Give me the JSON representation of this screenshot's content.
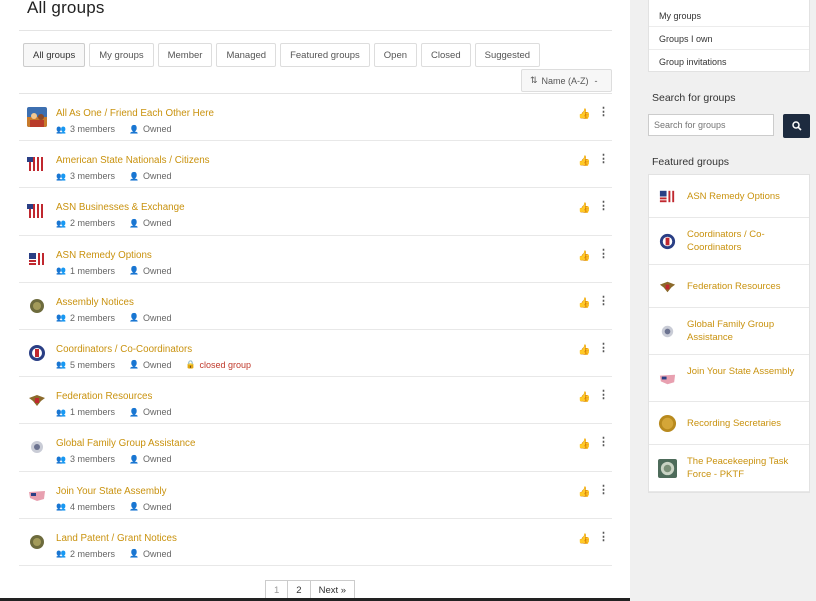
{
  "page": {
    "title": "All groups"
  },
  "tabs": [
    {
      "label": "All groups",
      "active": true
    },
    {
      "label": "My groups"
    },
    {
      "label": "Member"
    },
    {
      "label": "Managed"
    },
    {
      "label": "Featured groups"
    },
    {
      "label": "Open"
    },
    {
      "label": "Closed"
    },
    {
      "label": "Suggested"
    }
  ],
  "sort": {
    "label": "Name (A-Z)",
    "caret": "-"
  },
  "groups": [
    {
      "name": "All As One / Friend Each Other Here",
      "members": "3 members",
      "role": "Owned",
      "icon": "photo-avatar"
    },
    {
      "name": "American State Nationals / Citizens",
      "members": "3 members",
      "role": "Owned",
      "icon": "flag-stripes"
    },
    {
      "name": "ASN Businesses & Exchange",
      "members": "2 members",
      "role": "Owned",
      "icon": "flag-stripes"
    },
    {
      "name": "ASN Remedy Options",
      "members": "1 members",
      "role": "Owned",
      "icon": "flag-mini"
    },
    {
      "name": "Assembly Notices",
      "members": "2 members",
      "role": "Owned",
      "icon": "seal"
    },
    {
      "name": "Coordinators / Co-Coordinators",
      "members": "5 members",
      "role": "Owned",
      "closed": "closed group",
      "icon": "emblem"
    },
    {
      "name": "Federation Resources",
      "members": "1 members",
      "role": "Owned",
      "icon": "eagle"
    },
    {
      "name": "Global Family Group Assistance",
      "members": "3 members",
      "role": "Owned",
      "icon": "seal-grey"
    },
    {
      "name": "Join Your State Assembly",
      "members": "4 members",
      "role": "Owned",
      "icon": "map"
    },
    {
      "name": "Land Patent / Grant Notices",
      "members": "2 members",
      "role": "Owned",
      "icon": "seal"
    }
  ],
  "pagination": {
    "pages": [
      "1",
      "2"
    ],
    "current": "1",
    "next": "Next  »"
  },
  "sidebar": {
    "menu": [
      "My groups",
      "Groups I own",
      "Group invitations"
    ],
    "search_heading": "Search for groups",
    "search_placeholder": "Search for groups",
    "featured_heading": "Featured groups",
    "featured": [
      {
        "name": "ASN Remedy Options",
        "icon": "flag-mini"
      },
      {
        "name": "Coordinators / Co-Coordinators",
        "icon": "emblem"
      },
      {
        "name": "Federation Resources",
        "icon": "eagle"
      },
      {
        "name": "Global Family Group Assistance",
        "icon": "seal-grey"
      },
      {
        "name": "Join Your State Assembly",
        "icon": "map"
      },
      {
        "name": "Recording Secretaries",
        "icon": "seal-gold"
      },
      {
        "name": "The Peacekeeping Task Force - PKTF",
        "icon": "seal-green"
      }
    ]
  },
  "colors": {
    "link": "#c9920e",
    "closed": "#c0392b",
    "search_button": "#1d2b3f"
  }
}
